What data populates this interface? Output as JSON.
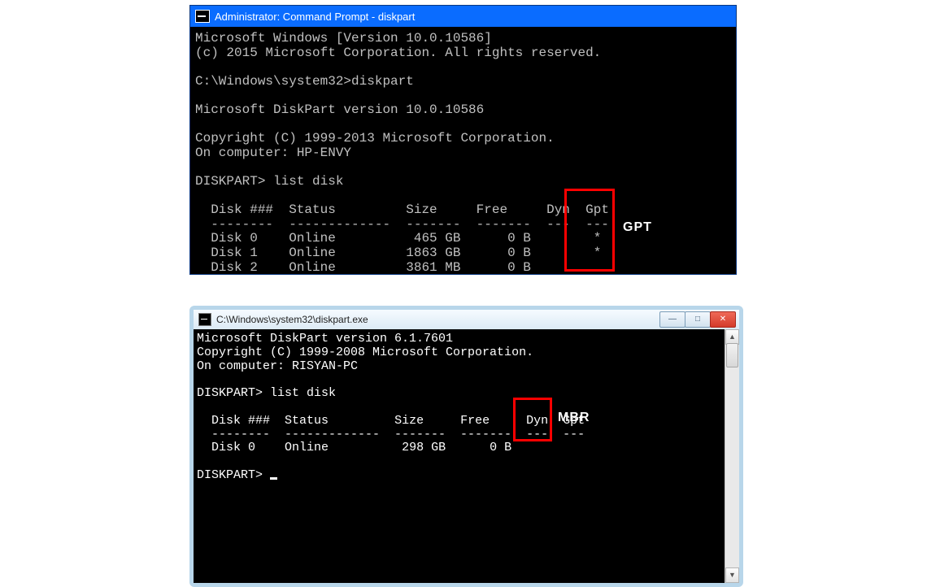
{
  "win1": {
    "title": "Administrator: Command Prompt - diskpart",
    "version_line": "Microsoft Windows [Version 10.0.10586]",
    "copyright_line": "(c) 2015 Microsoft Corporation. All rights reserved.",
    "prompt_path": "C:\\Windows\\system32>",
    "cmd": "diskpart",
    "dp_version": "Microsoft DiskPart version 10.0.10586",
    "dp_copyright": "Copyright (C) 1999-2013 Microsoft Corporation.",
    "dp_computer": "On computer: HP-ENVY",
    "dp_prompt": "DISKPART>",
    "dp_cmd": "list disk",
    "table": {
      "hdr_disk": "Disk ###",
      "hdr_status": "Status",
      "hdr_size": "Size",
      "hdr_free": "Free",
      "hdr_dyn": "Dyn",
      "hdr_gpt": "Gpt",
      "rows": [
        {
          "d": "Disk 0",
          "st": "Online",
          "sz": "465 GB",
          "fr": "0 B",
          "dyn": "",
          "gpt": "*"
        },
        {
          "d": "Disk 1",
          "st": "Online",
          "sz": "1863 GB",
          "fr": "0 B",
          "dyn": "",
          "gpt": "*"
        },
        {
          "d": "Disk 2",
          "st": "Online",
          "sz": "3861 MB",
          "fr": "0 B",
          "dyn": "",
          "gpt": ""
        }
      ]
    },
    "annotation": "GPT"
  },
  "win2": {
    "title": "C:\\Windows\\system32\\diskpart.exe",
    "btn_min": "—",
    "btn_max": "□",
    "btn_close": "✕",
    "dp_version": "Microsoft DiskPart version 6.1.7601",
    "dp_copyright": "Copyright (C) 1999-2008 Microsoft Corporation.",
    "dp_computer": "On computer: RISYAN-PC",
    "dp_prompt": "DISKPART>",
    "dp_cmd": "list disk",
    "table": {
      "hdr_disk": "Disk ###",
      "hdr_status": "Status",
      "hdr_size": "Size",
      "hdr_free": "Free",
      "hdr_dyn": "Dyn",
      "hdr_gpt": "Gpt",
      "rows": [
        {
          "d": "Disk 0",
          "st": "Online",
          "sz": "298 GB",
          "fr": "0 B",
          "dyn": "",
          "gpt": ""
        }
      ]
    },
    "annotation": "MBR",
    "scroll_up": "▲",
    "scroll_down": "▼"
  }
}
